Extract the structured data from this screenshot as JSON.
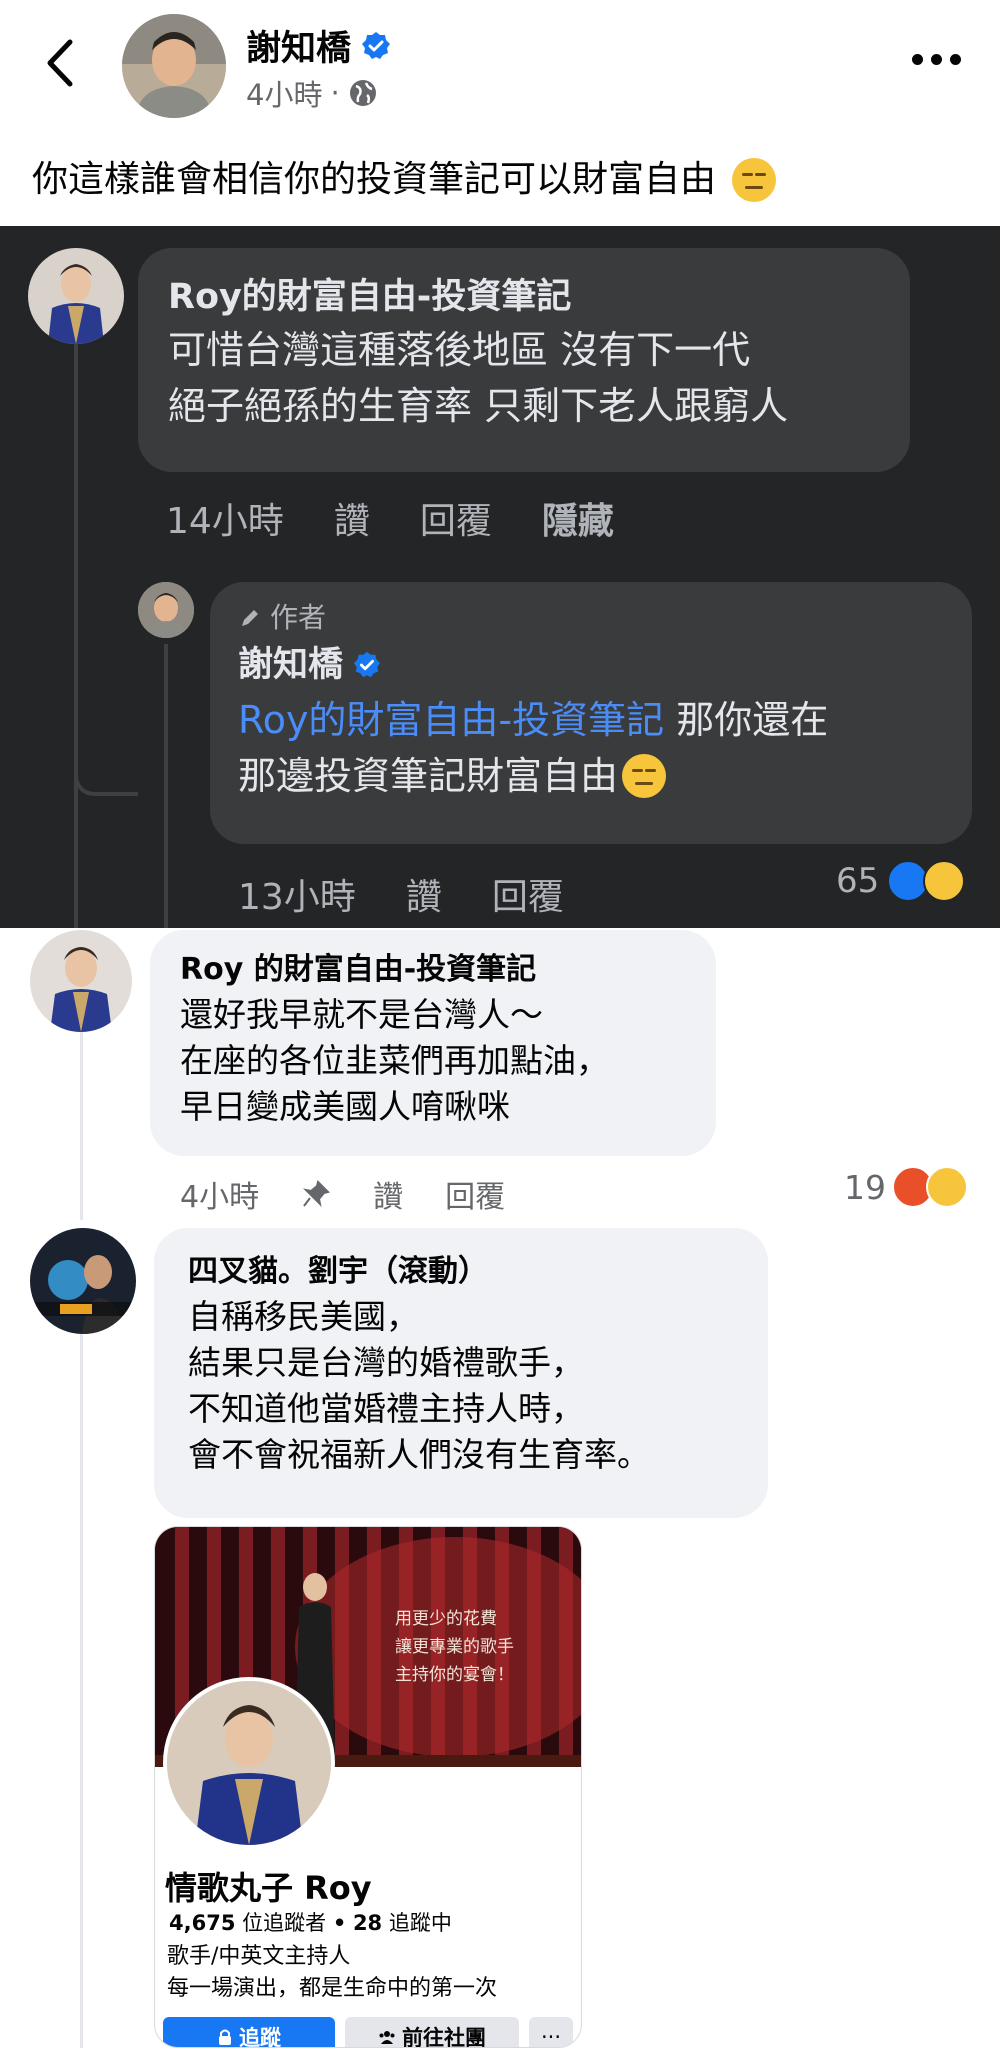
{
  "header": {
    "author_name": "謝知橋",
    "post_time": "4小時",
    "time_separator": "·"
  },
  "post": {
    "text": "你這樣誰會相信你的投資筆記可以財富自由"
  },
  "screenshot": {
    "comment1": {
      "name": "Roy的財富自由-投資筆記",
      "line1": "可惜台灣這種落後地區 沒有下一代",
      "line2": "絕子絕孫的生育率 只剩下老人跟窮人",
      "time": "14小時",
      "like": "讚",
      "reply": "回覆",
      "hide": "隱藏"
    },
    "reply1": {
      "author_label": "作者",
      "name": "謝知橋",
      "mention": "Roy的財富自由-投資筆記",
      "text_after_mention": " 那你還在",
      "line2": "那邊投資筆記財富自由",
      "time": "13小時",
      "like": "讚",
      "reply": "回覆",
      "reaction_count": "65"
    }
  },
  "comments": [
    {
      "name": "Roy 的財富自由-投資筆記",
      "lines": [
        "還好我早就不是台灣人～",
        "在座的各位韭菜們再加點油，",
        "早日變成美國人唷啾咪"
      ],
      "time": "4小時",
      "like": "讚",
      "reply": "回覆",
      "reaction_count": "19"
    },
    {
      "name": "四叉貓。劉宇（滾動）",
      "lines": [
        "自稱移民美國，",
        "結果只是台灣的婚禮歌手，",
        "不知道他當婚禮主持人時，",
        "會不會祝福新人們沒有生育率。"
      ]
    }
  ],
  "profile_card": {
    "cover_text": [
      "用更少的花費",
      "讓更專業的歌手",
      "主持你的宴會！"
    ],
    "name": "情歌丸子 Roy",
    "followers": "4,675",
    "followers_label": "位追蹤者",
    "following": "28",
    "following_label": "追蹤中",
    "stats_sep": "•",
    "desc1": "歌手/中英文主持人",
    "desc2": "每一場演出，都是生命中的第一次",
    "follow_button": "追蹤",
    "group_button": "前往社團",
    "more_button": "···"
  },
  "colors": {
    "facebook_blue": "#1877f2",
    "dark_bg": "#232527",
    "dark_bubble": "#3a3b3c",
    "mention_blue": "#4b8df8"
  }
}
